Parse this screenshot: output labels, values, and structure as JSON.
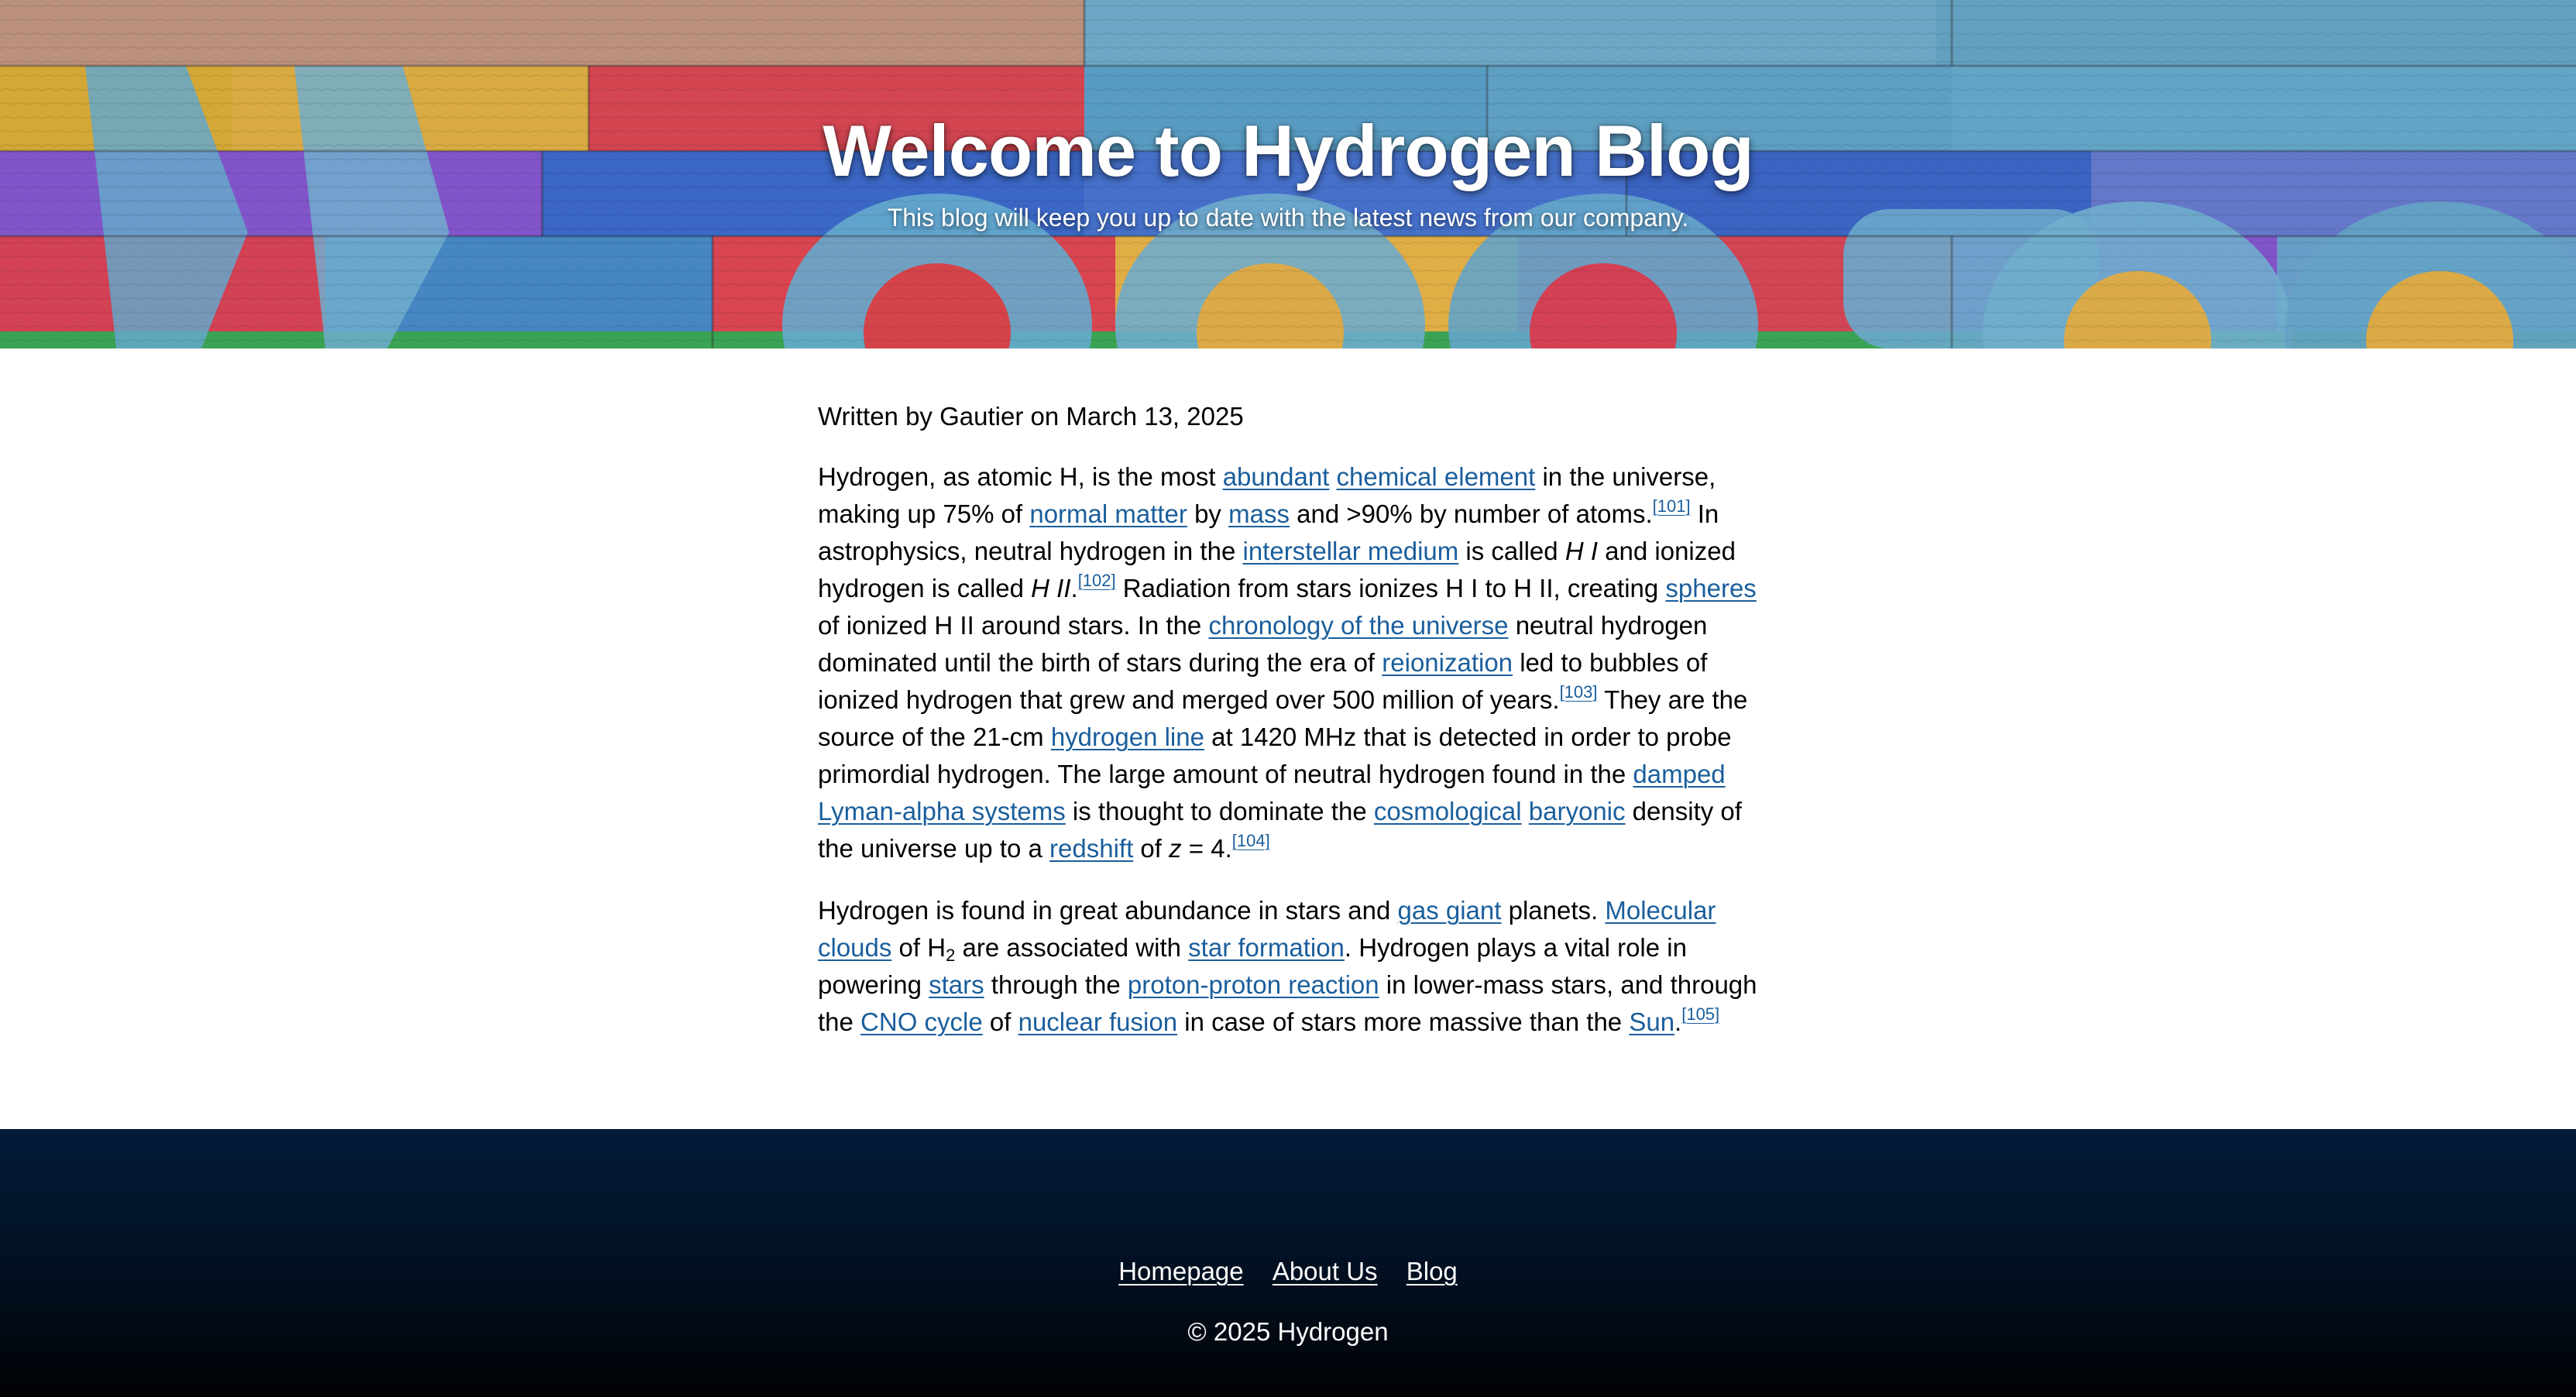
{
  "hero": {
    "title": "Welcome to Hydrogen Blog",
    "subtitle": "This blog will keep you up to date with the latest news from our company."
  },
  "article": {
    "byline": "Written by Gautier on March 13, 2025",
    "paragraphs": [
      [
        {
          "t": "Hydrogen, as atomic H, is the most "
        },
        {
          "link": "abundant"
        },
        {
          "t": " "
        },
        {
          "link": "chemical element"
        },
        {
          "t": " in the universe, making up 75% of "
        },
        {
          "link": "normal matter"
        },
        {
          "t": " by "
        },
        {
          "link": "mass"
        },
        {
          "t": " and >90% by number of atoms."
        },
        {
          "ref": "[101]"
        },
        {
          "t": " In astrophysics, neutral hydrogen in the "
        },
        {
          "link": "interstellar medium"
        },
        {
          "t": " is called "
        },
        {
          "em": "H I"
        },
        {
          "t": " and ionized hydrogen is called "
        },
        {
          "em": "H II"
        },
        {
          "t": "."
        },
        {
          "ref": "[102]"
        },
        {
          "t": " Radiation from stars ionizes H I to H II, creating "
        },
        {
          "link": "spheres"
        },
        {
          "t": " of ionized H II around stars. In the "
        },
        {
          "link": "chronology of the universe"
        },
        {
          "t": " neutral hydrogen dominated until the birth of stars during the era of "
        },
        {
          "link": "reionization"
        },
        {
          "t": " led to bubbles of ionized hydrogen that grew and merged over 500 million of years."
        },
        {
          "ref": "[103]"
        },
        {
          "t": " They are the source of the 21-cm "
        },
        {
          "link": "hydrogen line"
        },
        {
          "t": " at 1420 MHz that is detected in order to probe primordial hydrogen. The large amount of neutral hydrogen found in the "
        },
        {
          "link": "damped Lyman-alpha systems"
        },
        {
          "t": " is thought to dominate the "
        },
        {
          "link": "cosmological"
        },
        {
          "t": " "
        },
        {
          "link": "baryonic"
        },
        {
          "t": " density of the universe up to a "
        },
        {
          "link": "redshift"
        },
        {
          "t": " of "
        },
        {
          "em": "z"
        },
        {
          "t": " = 4."
        },
        {
          "ref": "[104]"
        }
      ],
      [
        {
          "t": "Hydrogen is found in great abundance in stars and "
        },
        {
          "link": "gas giant"
        },
        {
          "t": " planets. "
        },
        {
          "link": "Molecular clouds"
        },
        {
          "t": " of H"
        },
        {
          "sub": "2"
        },
        {
          "t": " are associated with "
        },
        {
          "link": "star formation"
        },
        {
          "t": ". Hydrogen plays a vital role in powering "
        },
        {
          "link": "stars"
        },
        {
          "t": " through the "
        },
        {
          "link": "proton-proton reaction"
        },
        {
          "t": " in lower-mass stars, and through the "
        },
        {
          "link": "CNO cycle"
        },
        {
          "t": " of "
        },
        {
          "link": "nuclear fusion"
        },
        {
          "t": " in case of stars more massive than the "
        },
        {
          "link": "Sun"
        },
        {
          "t": "."
        },
        {
          "ref": "[105]"
        }
      ]
    ]
  },
  "footer": {
    "nav": [
      "Homepage",
      "About Us",
      "Blog"
    ],
    "copyright": "© 2025 Hydrogen"
  },
  "colors": {
    "link": "#1a5e9c",
    "footer_top": "#031c39",
    "footer_bottom": "#010204"
  }
}
